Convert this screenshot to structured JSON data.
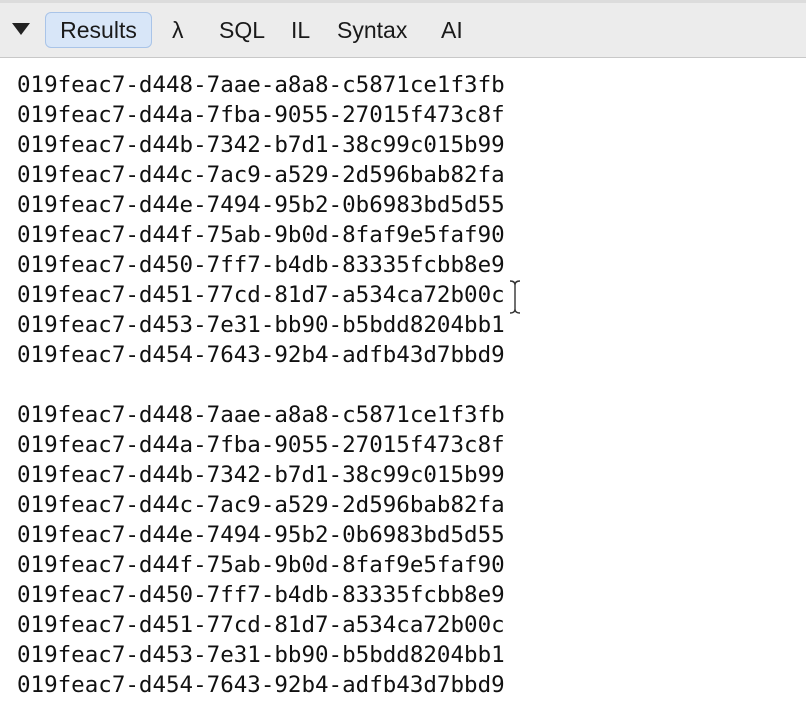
{
  "toolbar": {
    "tabs": [
      {
        "label": "Results",
        "selected": true
      },
      {
        "label": "λ",
        "selected": false
      },
      {
        "label": "SQL",
        "selected": false
      },
      {
        "label": "IL",
        "selected": false
      },
      {
        "label": "Syntax",
        "selected": false
      },
      {
        "label": "AI",
        "selected": false
      }
    ],
    "collapse_icon": "triangle-down-icon"
  },
  "results": {
    "lines": [
      "019feac7-d448-7aae-a8a8-c5871ce1f3fb",
      "019feac7-d44a-7fba-9055-27015f473c8f",
      "019feac7-d44b-7342-b7d1-38c99c015b99",
      "019feac7-d44c-7ac9-a529-2d596bab82fa",
      "019feac7-d44e-7494-95b2-0b6983bd5d55",
      "019feac7-d44f-75ab-9b0d-8faf9e5faf90",
      "019feac7-d450-7ff7-b4db-83335fcbb8e9",
      "019feac7-d451-77cd-81d7-a534ca72b00c",
      "019feac7-d453-7e31-bb90-b5bdd8204bb1",
      "019feac7-d454-7643-92b4-adfb43d7bbd9",
      "",
      "019feac7-d448-7aae-a8a8-c5871ce1f3fb",
      "019feac7-d44a-7fba-9055-27015f473c8f",
      "019feac7-d44b-7342-b7d1-38c99c015b99",
      "019feac7-d44c-7ac9-a529-2d596bab82fa",
      "019feac7-d44e-7494-95b2-0b6983bd5d55",
      "019feac7-d44f-75ab-9b0d-8faf9e5faf90",
      "019feac7-d450-7ff7-b4db-83335fcbb8e9",
      "019feac7-d451-77cd-81d7-a534ca72b00c",
      "019feac7-d453-7e31-bb90-b5bdd8204bb1",
      "019feac7-d454-7643-92b4-adfb43d7bbd9"
    ]
  },
  "cursor_icon": "text-cursor-icon"
}
